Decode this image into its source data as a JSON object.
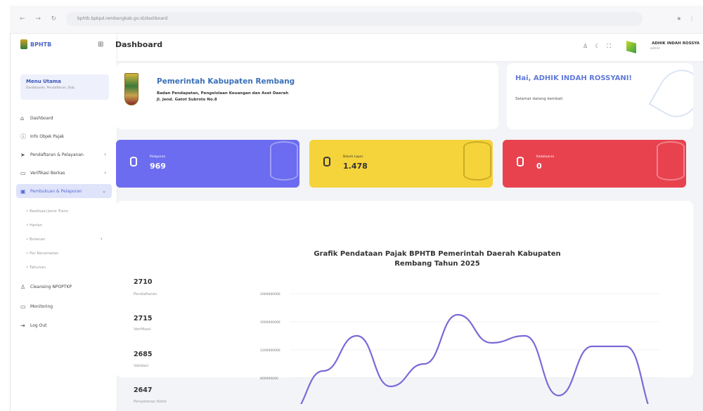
{
  "browser": {
    "url": "bphtb.bpkpd.rembangkab.go.id/dashboard"
  },
  "sidebar": {
    "logo_text": "BPHTB",
    "menu_title": "Menu Utama",
    "menu_sub": "Dashboards, Pendaftaran, Dsb.",
    "items": [
      {
        "label": "Dashboard",
        "icon": "home-icon"
      },
      {
        "label": "Info Objek Pajak",
        "icon": "info-icon"
      },
      {
        "label": "Pendaftaran & Pelayanan",
        "icon": "send-icon"
      },
      {
        "label": "Verifikasi Berkas",
        "icon": "file-icon"
      },
      {
        "label": "Pembukuan & Pelaporan",
        "icon": "book-icon"
      }
    ],
    "subitems": [
      "Realisasi Jenis Trans",
      "Harian",
      "Bulanan",
      "Per Kecamatan",
      "Tahunan"
    ],
    "bottom_items": [
      {
        "label": "Cleansing NPOPTKP",
        "icon": "users-icon"
      },
      {
        "label": "Monitoring",
        "icon": "monitor-icon"
      },
      {
        "label": "Log Out",
        "icon": "logout-icon"
      }
    ]
  },
  "topbar": {
    "user_name": "ADHIK INDAH ROSSYA",
    "user_role": "admin"
  },
  "page_title": "Dashboard",
  "gov": {
    "title": "Pemerintah Kabupaten Rembang",
    "subtitle": "Badan Pendapatan, Pengelolaan Keuangan dan Aset Daerah",
    "address": "Jl. Jend. Gatot Subroto No.8"
  },
  "greeting": {
    "title": "Hai, ADHIK INDAH ROSSYANI!",
    "subtitle": "Selamat datang kembali"
  },
  "stats": [
    {
      "label": "Pelaporan",
      "value": "969",
      "color": "#6c6cf0"
    },
    {
      "label": "Belum Lapor",
      "value": "1.478",
      "color": "#f5d33a"
    },
    {
      "label": "Kadaluarsa",
      "value": "0",
      "color": "#e8424f"
    }
  ],
  "side_stats": [
    {
      "value": "2710",
      "label": "Pendaftaran"
    },
    {
      "value": "2715",
      "label": "Verifikasi"
    },
    {
      "value": "2685",
      "label": "Validasi"
    },
    {
      "value": "2647",
      "label": "Penyetoran Kohir"
    }
  ],
  "chart_data": {
    "type": "line",
    "title": "Grafik Pendataan Pajak BPHTB Pemerintah Daerah Kabupaten Rembang Tahun 2025",
    "yticks": [
      "2000000000",
      "1600000000",
      "1200000000",
      "800000000"
    ],
    "values": [
      300000000,
      900000000,
      1400000000,
      680000000,
      1000000000,
      1700000000,
      1300000000,
      1400000000,
      550000000,
      1250000000,
      1250000000,
      200000000
    ],
    "color": "#7a6ad8"
  }
}
